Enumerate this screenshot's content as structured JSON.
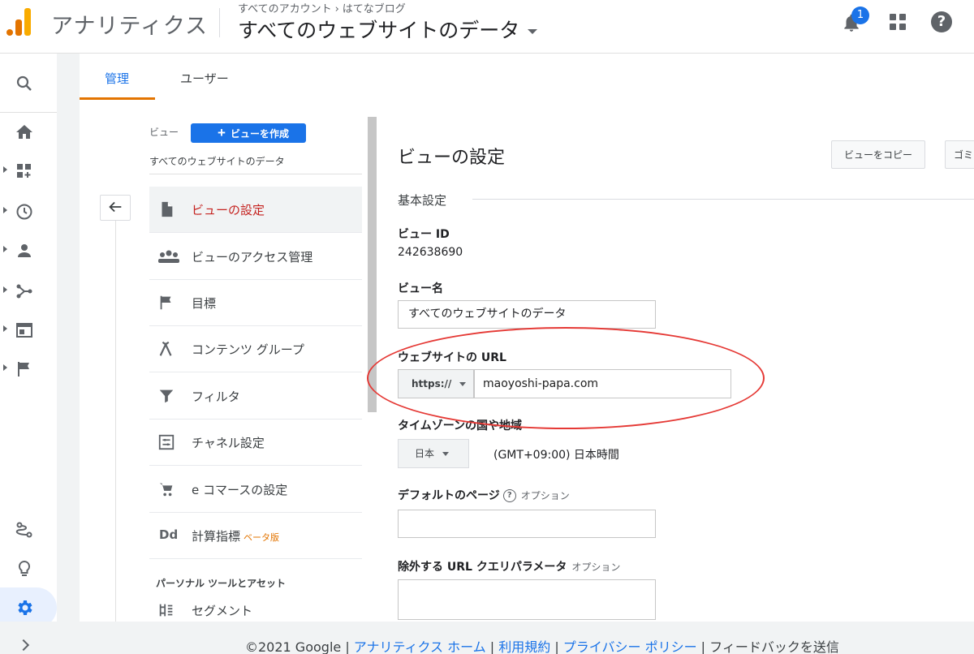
{
  "header": {
    "app_name": "アナリティクス",
    "breadcrumb_account": "すべてのアカウント",
    "breadcrumb_property": "はてなブログ",
    "property_view": "すべてのウェブサイトのデータ",
    "notification_count": "1"
  },
  "tabs": [
    {
      "label": "管理"
    },
    {
      "label": "ユーザー"
    }
  ],
  "nav": {
    "view_label": "ビュー",
    "create_view": "ビューを作成",
    "current_view": "すべてのウェブサイトのデータ",
    "items": [
      {
        "label": "ビューの設定",
        "icon": "document-icon"
      },
      {
        "label": "ビューのアクセス管理",
        "icon": "people-icon"
      },
      {
        "label": "目標",
        "icon": "flag-icon"
      },
      {
        "label": "コンテンツ グループ",
        "icon": "content-group-icon"
      },
      {
        "label": "フィルタ",
        "icon": "filter-icon"
      },
      {
        "label": "チャネル設定",
        "icon": "channel-icon"
      },
      {
        "label": "e コマースの設定",
        "icon": "cart-icon"
      },
      {
        "label": "計算指標",
        "icon": "dd-icon",
        "badge": "ベータ版"
      }
    ],
    "section_header": "パーソナル ツールとアセット",
    "segment": "セグメント"
  },
  "settings": {
    "title": "ビューの設定",
    "copy_button": "ビューをコピー",
    "trash_button": "ゴミ",
    "basic_header": "基本設定",
    "view_id_label": "ビュー ID",
    "view_id_value": "242638690",
    "view_name_label": "ビュー名",
    "view_name_value": "すべてのウェブサイトのデータ",
    "website_url_label": "ウェブサイトの URL",
    "protocol": "https://",
    "website_url_value": "maoyoshi-papa.com",
    "timezone_label": "タイムゾーンの国や地域",
    "timezone_country": "日本",
    "timezone_value": "(GMT+09:00) 日本時間",
    "default_page_label": "デフォルトのページ",
    "optional": "オプション",
    "exclude_params_label": "除外する URL クエリパラメータ"
  },
  "footer": {
    "copyright": "©2021 Google",
    "link_home": "アナリティクス ホーム",
    "link_terms": "利用規約",
    "link_privacy": "プライバシー ポリシー",
    "feedback": "フィードバックを送信"
  },
  "colors": {
    "accent": "#1a73e8",
    "orange": "#e37400",
    "annotation_red": "#e53935"
  }
}
